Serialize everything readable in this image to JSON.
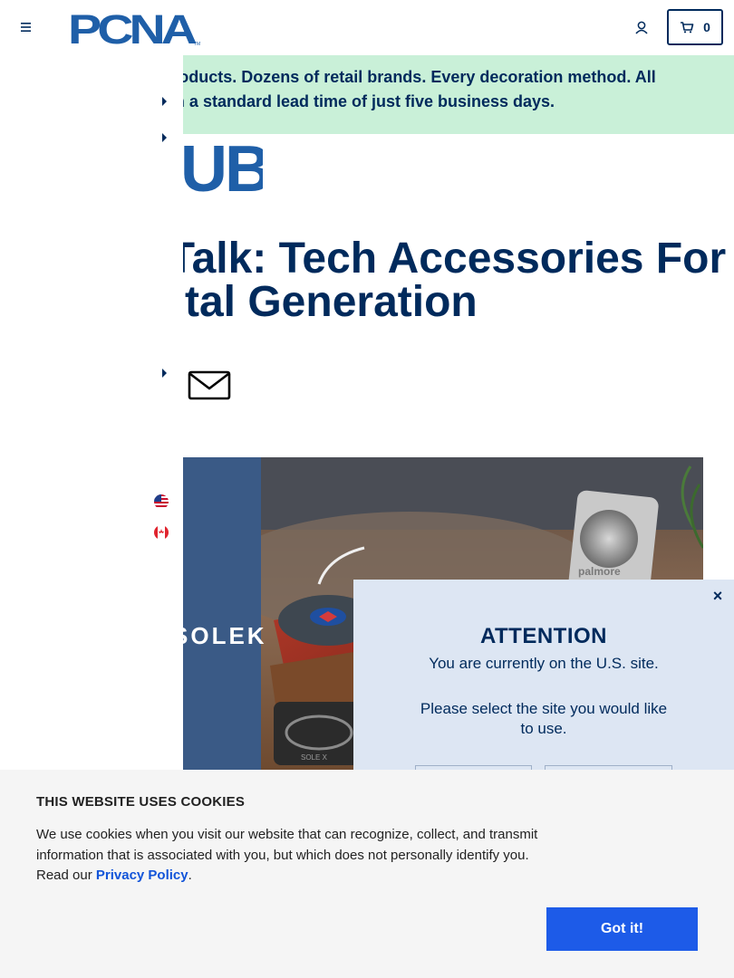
{
  "header": {
    "logo_text": "PCNA",
    "logo_tm": "TM",
    "cart_count": "0"
  },
  "promo": {
    "line1": "Thousands of products. Dozens of retail brands. Every decoration method. All",
    "line2": "with a standard lead time of just five business days."
  },
  "hub": {
    "logo_text": "HUB"
  },
  "hero": {
    "title_line1": "Tech Talk: Tech Accessories For",
    "title_line2": "the Digital Generation",
    "image_brand_left": "SOLEK",
    "image_brand_right": "palmore",
    "image_brand_bottom": "SOLE X"
  },
  "modal": {
    "close": "×",
    "title": "ATTENTION",
    "text1": "You are currently on the U.S. site.",
    "text2": "Please select the site you would like to use."
  },
  "cookie": {
    "title": "THIS WEBSITE USES COOKIES",
    "text_before": "We use cookies when you visit our website that can recognize, collect, and transmit information that is associated with you, but which does not personally identify you. Read our ",
    "link": "Privacy Policy",
    "text_after": ".",
    "button": "Got it!"
  },
  "colors": {
    "navy": "#002a5c",
    "promo_bg": "#c9f0d8",
    "modal_bg": "#dde6f3",
    "cookie_btn": "#1d5be8",
    "link": "#1254d9"
  }
}
